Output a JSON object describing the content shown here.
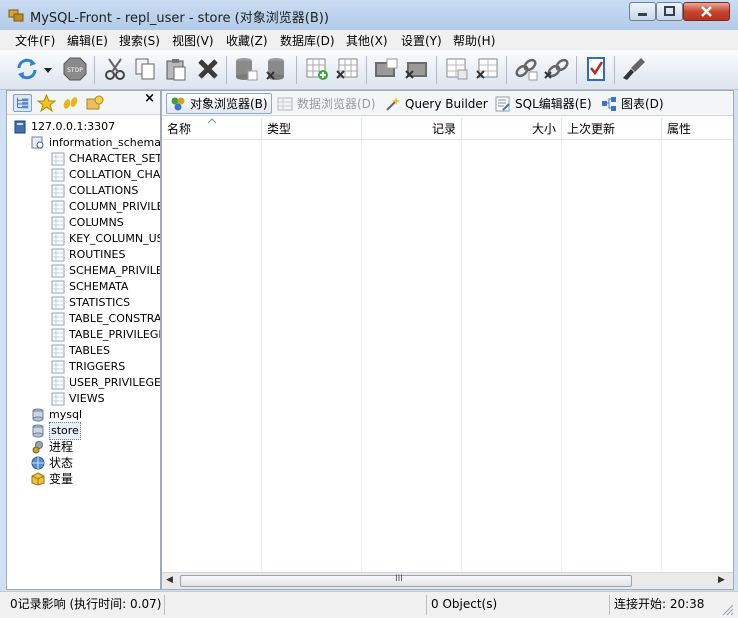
{
  "window": {
    "title": "MySQL-Front - repl_user - store  (对象浏览器(B))"
  },
  "menu": [
    "文件(F)",
    "编辑(E)",
    "搜索(S)",
    "视图(V)",
    "收藏(Z)",
    "数据库(D)",
    "其他(X)",
    "设置(Y)",
    "帮助(H)"
  ],
  "toolbar": {
    "buttons": [
      {
        "icon": "refresh-icon"
      },
      {
        "icon": "dropdown-arrow-icon"
      },
      {
        "icon": "stop-icon",
        "label": "STOP"
      },
      {
        "icon": "cut-icon"
      },
      {
        "icon": "copy-icon"
      },
      {
        "icon": "paste-icon"
      },
      {
        "icon": "delete-icon"
      },
      {
        "icon": "add-database-icon"
      },
      {
        "icon": "delete-database-icon"
      },
      {
        "icon": "add-table-icon"
      },
      {
        "icon": "delete-table-icon"
      },
      {
        "icon": "add-view-icon"
      },
      {
        "icon": "edit-view-icon"
      },
      {
        "icon": "add-field-icon"
      },
      {
        "icon": "delete-field-icon"
      },
      {
        "icon": "add-link-icon"
      },
      {
        "icon": "delete-link-icon"
      },
      {
        "icon": "checklist-icon"
      },
      {
        "icon": "brush-icon"
      }
    ]
  },
  "left_panel": {
    "close_label": "×",
    "tree": {
      "server": "127.0.0.1:3307",
      "schema": "information_schema",
      "tables": [
        "CHARACTER_SETS",
        "COLLATION_CHAR",
        "COLLATIONS",
        "COLUMN_PRIVILEG",
        "COLUMNS",
        "KEY_COLUMN_USA",
        "ROUTINES",
        "SCHEMA_PRIVILEG",
        "SCHEMATA",
        "STATISTICS",
        "TABLE_CONSTRAI",
        "TABLE_PRIVILEGES",
        "TABLES",
        "TRIGGERS",
        "USER_PRIVILEGES",
        "VIEWS"
      ],
      "databases": [
        "mysql",
        "store"
      ],
      "extras": [
        "进程",
        "状态",
        "变量"
      ]
    }
  },
  "main_panel": {
    "tabs": [
      {
        "label": "对象浏览器(B)",
        "icon": "object-browser-icon",
        "state": "active"
      },
      {
        "label": "数据浏览器(D)",
        "icon": "data-browser-icon",
        "state": "disabled"
      },
      {
        "label": "Query Builder",
        "icon": "query-builder-icon",
        "state": "normal"
      },
      {
        "label": "SQL编辑器(E)",
        "icon": "sql-editor-icon",
        "state": "normal"
      },
      {
        "label": "图表(D)",
        "icon": "diagram-icon",
        "state": "normal"
      }
    ],
    "columns": [
      "名称",
      "类型",
      "记录",
      "大小",
      "上次更新",
      "属性"
    ],
    "scroll_grip": "III"
  },
  "status": {
    "left": "0记录影响  (执行时间: 0.07)",
    "center": "0 Object(s)",
    "right": "连接开始: 20:38"
  }
}
